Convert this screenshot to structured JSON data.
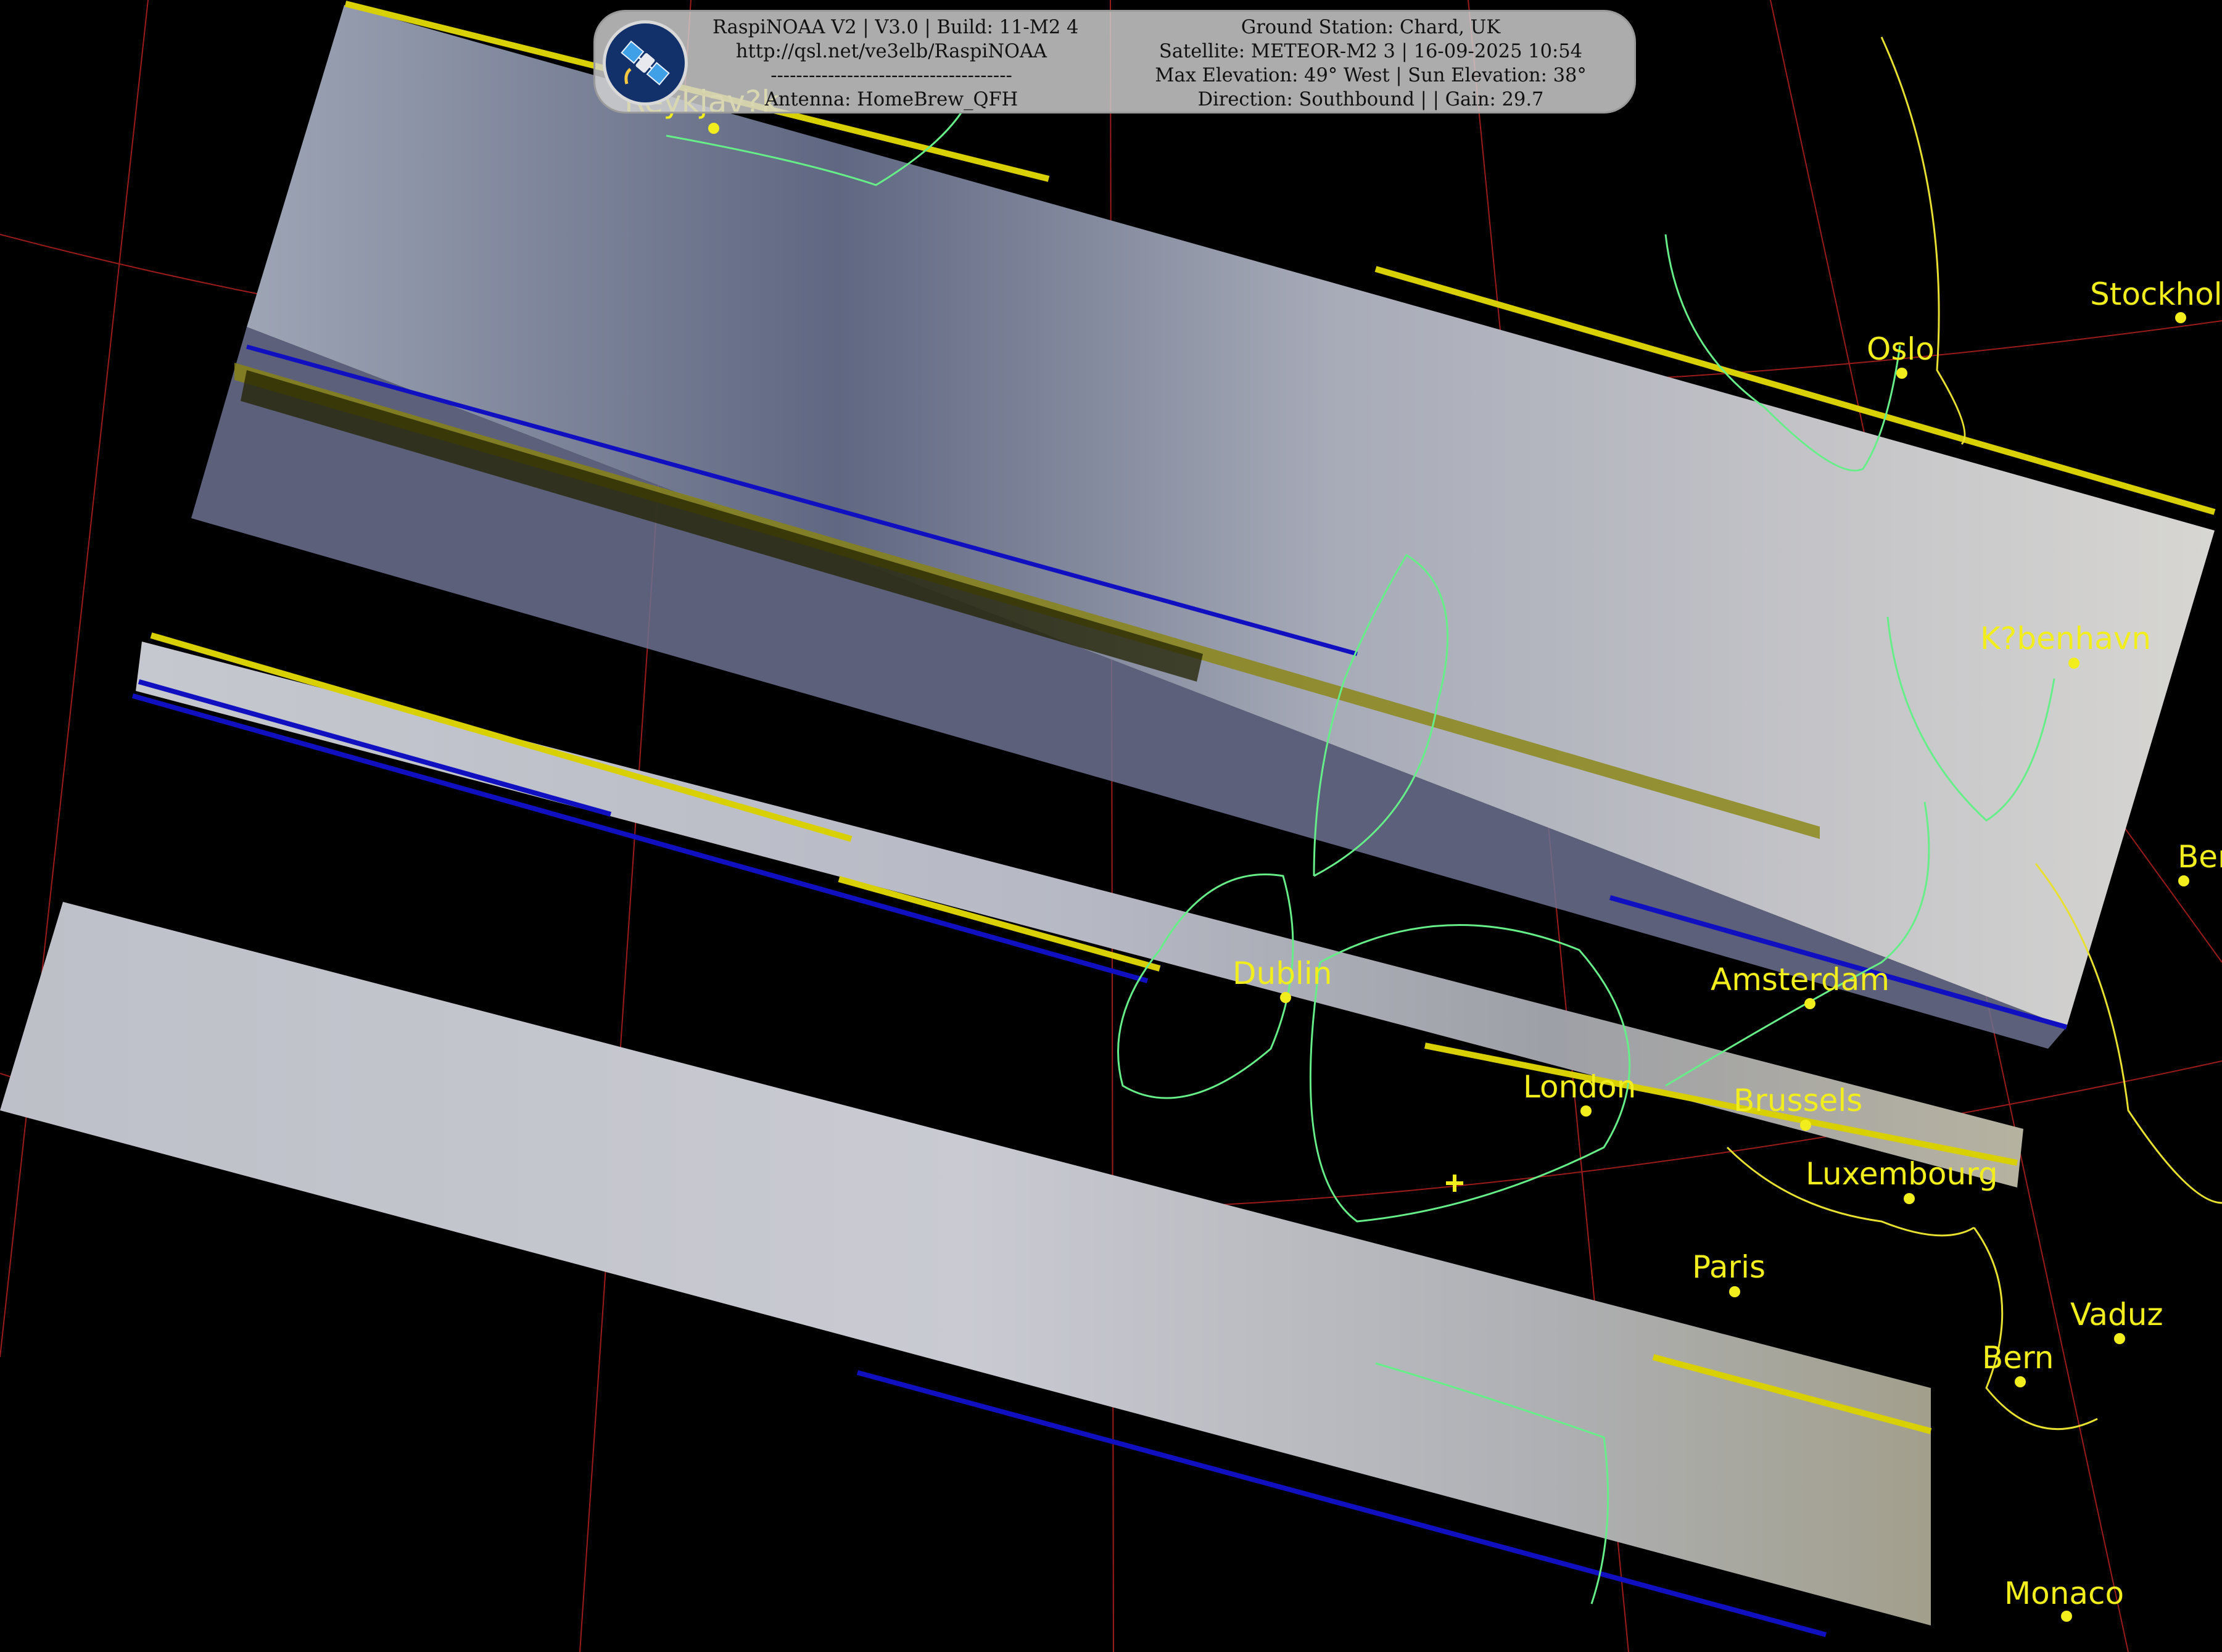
{
  "info_panel": {
    "left_lines": [
      "RaspiNOAA V2 | V3.0 | Build: 11-M2 4",
      "http://qsl.net/ve3elb/RaspiNOAA",
      "--------------------------------------",
      "Antenna: HomeBrew_QFH"
    ],
    "right_lines": [
      "Ground Station: Chard, UK",
      "Satellite: METEOR-M2 3 | 16-09-2025 10:54",
      "Max Elevation: 49° West | Sun Elevation: 38°",
      "Direction: Southbound | | Gain: 29.7"
    ],
    "logo_icon": "satellite-icon"
  },
  "cities": [
    {
      "name": "Reykjav?k"
    },
    {
      "name": "Oslo"
    },
    {
      "name": "Stockholm"
    },
    {
      "name": "K?benhavn"
    },
    {
      "name": "Berlin"
    },
    {
      "name": "Amsterdam"
    },
    {
      "name": "Dublin"
    },
    {
      "name": "London"
    },
    {
      "name": "Brussels"
    },
    {
      "name": "Luxembourg"
    },
    {
      "name": "Paris"
    },
    {
      "name": "Vaduz"
    },
    {
      "name": "Bern"
    },
    {
      "name": "Monaco"
    }
  ],
  "ground_station_marker": "plus-marker",
  "colors": {
    "background": "#000000",
    "city_labels": "#f2ee1e",
    "coastlines": "#66ee88",
    "borders": "#e8e030",
    "graticule": "#b82020",
    "panel": "#d2d2d2"
  }
}
